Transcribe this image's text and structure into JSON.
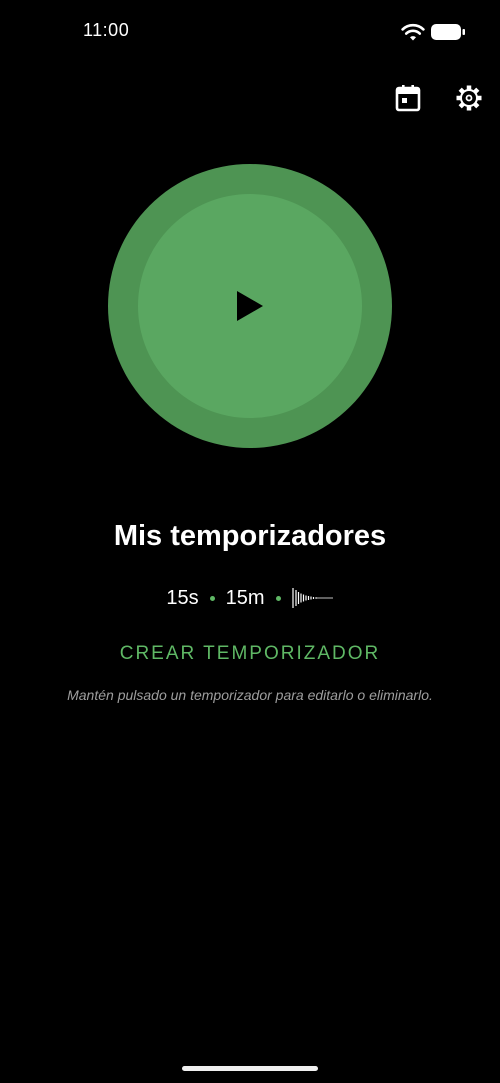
{
  "status_bar": {
    "time": "11:00",
    "icons": [
      "wifi-icon",
      "battery-icon"
    ]
  },
  "toolbar": {
    "icons": [
      "calendar-icon",
      "gear-icon"
    ]
  },
  "timer": {
    "action_icon": "play-icon",
    "outer_color": "#4e9453",
    "inner_color": "#5aa761"
  },
  "main": {
    "title": "Mis temporizadores",
    "timers": [
      "15s",
      "15m"
    ],
    "sound_icon": "waveform-icon",
    "create_label": "CREAR TEMPORIZADOR",
    "hint": "Mantén pulsado un temporizador para editarlo o eliminarlo."
  },
  "colors": {
    "accent": "#5fb865",
    "background": "#000000",
    "hint_text": "#9e9e9e"
  }
}
